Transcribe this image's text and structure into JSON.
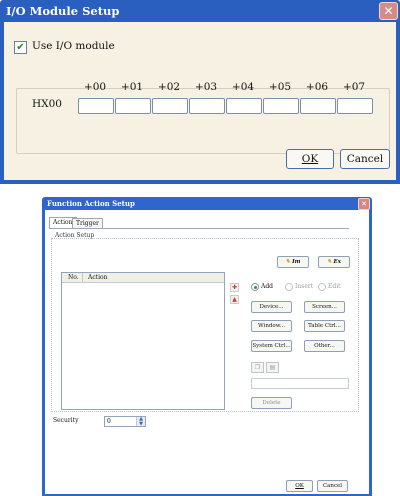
{
  "io_dialog": {
    "title": "I/O Module Setup",
    "close_glyph": "✕",
    "use_module_label": "Use I/O module",
    "use_module_checked": true,
    "row_label": "HX00",
    "offsets": [
      "+00",
      "+01",
      "+02",
      "+03",
      "+04",
      "+05",
      "+06",
      "+07"
    ],
    "ok_label": "OK",
    "cancel_label": "Cancel"
  },
  "action_dialog": {
    "title": "Function Action Setup",
    "close_glyph": "✕",
    "tabs": [
      "Action",
      "Trigger"
    ],
    "group_label": "Action Setup",
    "list_headers": [
      "No.",
      "Action"
    ],
    "import_label": "Im",
    "export_label": "Ex",
    "mode_options": [
      "Add",
      "Insert",
      "Edit"
    ],
    "selected_mode": "Add",
    "buttons": [
      "Device...",
      "Screen...",
      "Window...",
      "Table Ctrl...",
      "System Ctrl...",
      "Other..."
    ],
    "delete_label": "Delete",
    "security_label": "Security",
    "security_value": "0",
    "ok_label": "OK",
    "cancel_label": "Cancel"
  }
}
